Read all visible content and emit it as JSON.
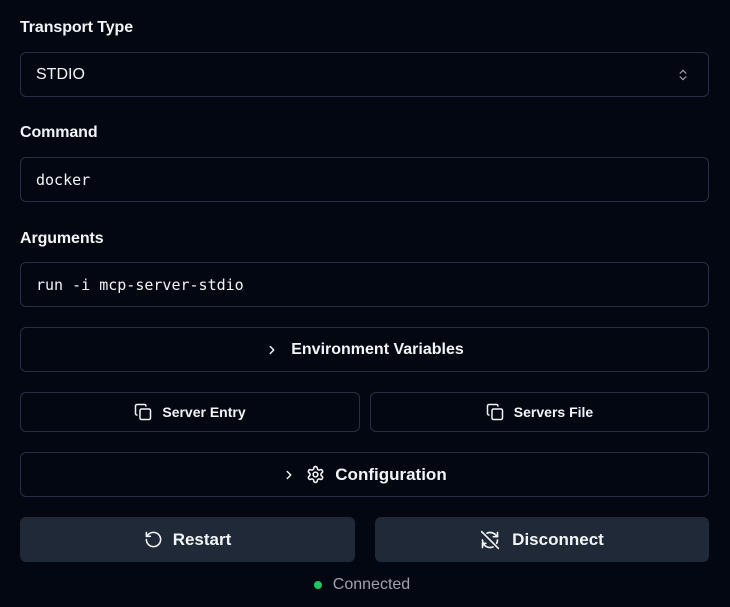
{
  "transport": {
    "label": "Transport Type",
    "selected": "STDIO",
    "chevron_icon": "chevrons-up-down-icon"
  },
  "command": {
    "label": "Command",
    "value": "docker"
  },
  "arguments": {
    "label": "Arguments",
    "value": "run -i mcp-server-stdio"
  },
  "env_vars": {
    "label": "Environment Variables",
    "icon": "chevron-right-icon"
  },
  "copy_buttons": {
    "server_entry": "Server Entry",
    "servers_file": "Servers File",
    "icon": "copy-icon"
  },
  "configuration": {
    "label": "Configuration",
    "chevron_icon": "chevron-right-icon",
    "gear_icon": "settings-icon"
  },
  "actions": {
    "restart": "Restart",
    "restart_icon": "rotate-ccw-icon",
    "disconnect": "Disconnect",
    "disconnect_icon": "unplug-refresh-off-icon"
  },
  "status": {
    "text": "Connected",
    "color": "#22c55e"
  },
  "colors": {
    "background": "#030712",
    "border": "#273043",
    "solid_button": "#1f2937",
    "text": "#f3f4f6",
    "muted_text": "#9ca3af"
  }
}
